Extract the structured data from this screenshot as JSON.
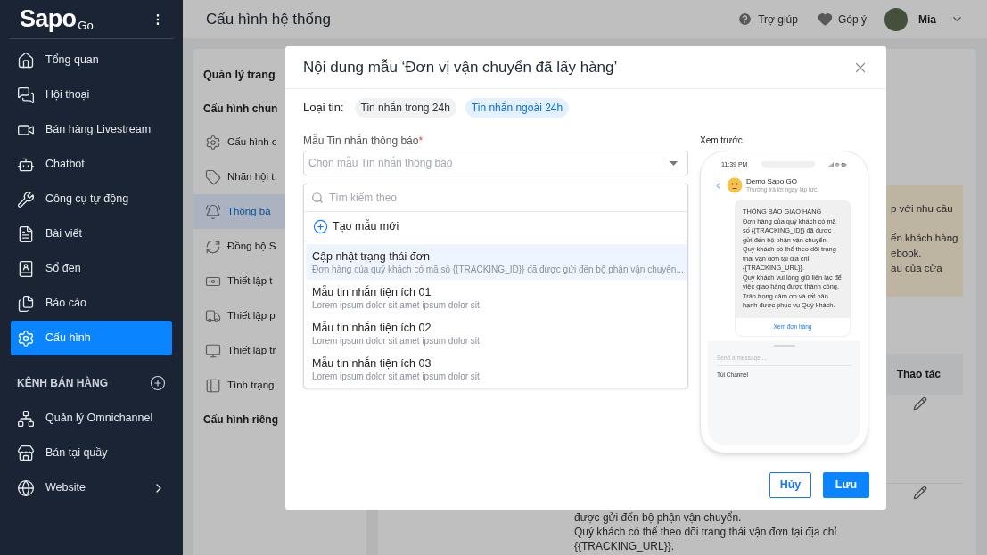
{
  "sidebar": {
    "logo": "Sapo",
    "logo_suffix": "Go",
    "items": [
      {
        "label": "Tổng quan",
        "selected": false
      },
      {
        "label": "Hội thoại",
        "selected": false
      },
      {
        "label": "Bán hàng Livestream",
        "selected": false
      },
      {
        "label": "Chatbot",
        "selected": false
      },
      {
        "label": "Công cụ tự động",
        "selected": false
      },
      {
        "label": "Bài viết",
        "selected": false
      },
      {
        "label": "Sổ đen",
        "selected": false
      },
      {
        "label": "Báo cáo",
        "selected": false
      },
      {
        "label": "Cấu hình",
        "selected": true
      }
    ],
    "section_title": "KÊNH BÁN HÀNG",
    "channels": [
      {
        "label": "Quản lý Omnichannel",
        "expandable": false
      },
      {
        "label": "Bán tại quầy",
        "expandable": false
      },
      {
        "label": "Website",
        "expandable": true
      }
    ]
  },
  "header": {
    "title": "Cấu hình hệ thống",
    "help": "Trợ giúp",
    "feedback": "Góp ý",
    "user": "Mia"
  },
  "settings": {
    "page_title": "Quản lý trang",
    "general_title": "Cấu hình chun",
    "items": [
      {
        "label": "Cấu hình c",
        "selected": false
      },
      {
        "label": "Nhãn hội t",
        "selected": false
      },
      {
        "label": "Thông bá",
        "selected": true
      },
      {
        "label": "Đồng bộ S",
        "selected": false
      },
      {
        "label": "Thiết lập t",
        "selected": false
      },
      {
        "label": "Thiết lập p",
        "selected": false
      },
      {
        "label": "Thiết lập tr",
        "selected": false
      },
      {
        "label": "Tình trạng",
        "selected": false
      }
    ],
    "private_title": "Cấu hình riêng"
  },
  "content": {
    "notice_lines": [
      "p với nhu cầu",
      "ến khách hàng",
      "ebook.",
      "ầu của cửa"
    ],
    "table_action_header": "Thao tác",
    "footer_lines": [
      "được gửi đến bộ phận vận chuyển.",
      "Quý khách có thể theo dõi trạng thái vận đơn tại địa chỉ",
      "{{TRACKING_URL}}."
    ]
  },
  "modal": {
    "title": "Nội dung mẫu ‘Đơn vị vận chuyển đã lấy hàng’",
    "type_label": "Loại tin:",
    "types": [
      {
        "label": "Tin nhắn trong 24h",
        "selected": false
      },
      {
        "label": "Tin nhắn ngoài 24h",
        "selected": true
      }
    ],
    "template_label": "Mẫu Tin nhắn thông báo",
    "required_mark": "*",
    "template_select": {
      "placeholder": "Chọn mẫu Tin nhắn thông báo",
      "expanded": true
    },
    "search": {
      "placeholder": "Tìm kiếm theo"
    },
    "create": "Tạo mẫu mới",
    "templates": [
      {
        "title": "Cập nhật trạng thái đơn",
        "desc": "Đơn hàng của quý khách có mã số {{TRACKING_ID}} đã được gửi đến bộ phận vận chuyển...",
        "selected": true
      },
      {
        "title": "Mẫu tin nhắn tiện ích 01",
        "desc": "Lorem ipsum dolor sit amet ipsum dolor sit",
        "selected": false
      },
      {
        "title": "Mẫu tin nhắn tiện ích 02",
        "desc": "Lorem ipsum dolor sit amet ipsum dolor sit",
        "selected": false
      },
      {
        "title": "Mẫu tin nhắn tiện ích 03",
        "desc": "Lorem ipsum dolor sit amet ipsum dolor sit",
        "selected": false
      }
    ],
    "preview": {
      "label": "Xem trước",
      "time": "11:39 PM",
      "page_name": "Demo Sapo GO",
      "status": "Thường trả lời ngay lập tức",
      "message": "THÔNG BÁO GIAO HÀNG\nĐơn hàng của quý khách có mã số {{TRACKING_ID}} đã được gửi đến bộ phận vận chuyển.\nQuý khách có thể theo dõi trạng thái vận đơn tại địa chỉ {{TRACKING_URL}}.\nQuý khách vui lòng giữ liên lạc để việc giao hàng được thành công.\nTrân trọng cảm ơn và rất hân hạnh được phục vụ Quý khách.",
      "message_button": "Xem đơn hàng",
      "input_placeholder": "Send a message ...",
      "channel": "Túi Channel"
    },
    "cancel": "Hủy",
    "save": "Lưu"
  }
}
